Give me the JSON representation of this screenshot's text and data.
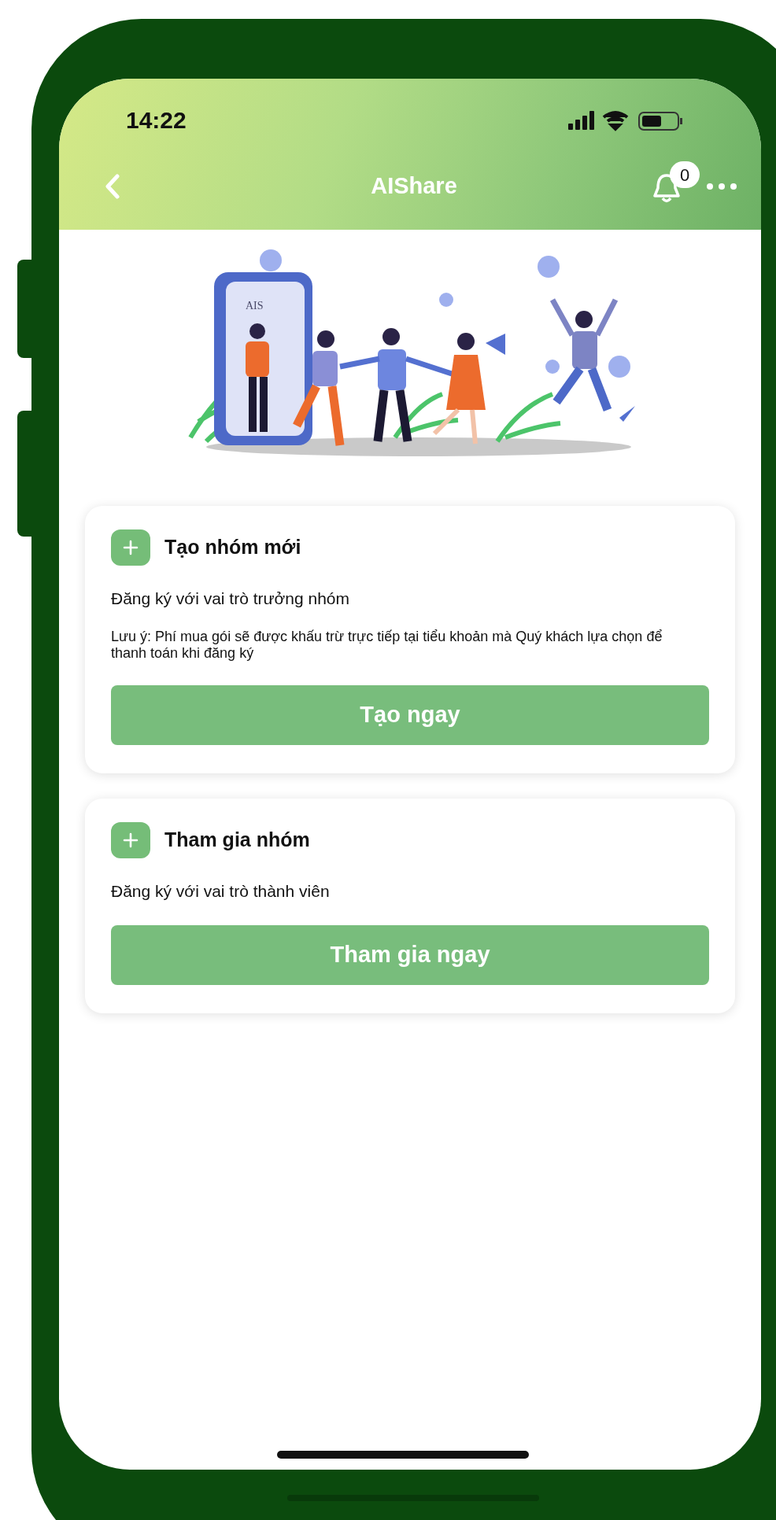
{
  "status_bar": {
    "time": "14:22"
  },
  "header": {
    "title": "AIShare",
    "notification_count": "0"
  },
  "illustration": {
    "logo_text": "AIS"
  },
  "cards": [
    {
      "title": "Tạo nhóm mới",
      "subtitle": "Đăng ký với vai trò trưởng nhóm",
      "note": "Lưu ý: Phí mua gói sẽ được khấu trừ trực tiếp tại tiểu khoản mà Quý khách lựa chọn để thanh toán khi đăng ký",
      "button": "Tạo ngay"
    },
    {
      "title": "Tham gia nhóm",
      "subtitle": "Đăng ký với vai trò thành viên",
      "button": "Tham gia ngay"
    }
  ]
}
